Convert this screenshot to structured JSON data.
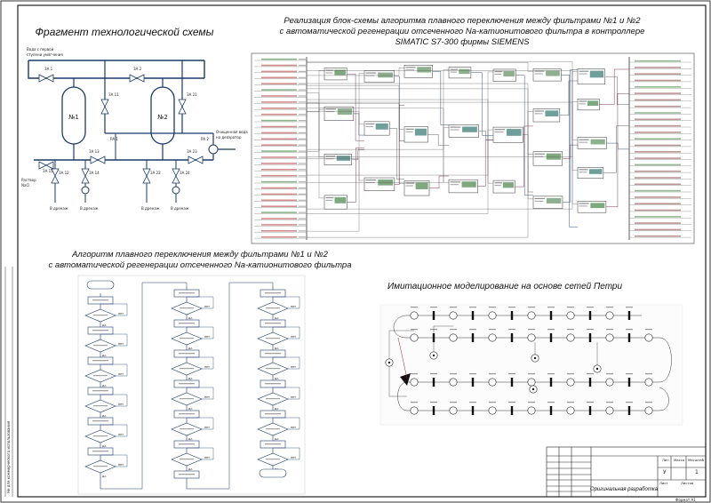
{
  "titles": {
    "tech_scheme": "Фрагмент технологической схемы",
    "plc_impl_lines": [
      "Реализация блок-схемы алгоритма плавного переключения между фильтрами №1 и №2",
      "с автоматической регенерации отсеченного Na-катионитового фильтра в контроллере",
      "SIMATIC S7-300 фирмы SIEMENS"
    ],
    "algorithm_lines": [
      "Алгоритм плавного переключения между фильтрами №1 и №2",
      "с автоматической регенерации отсеченного Na-катионитового фильтра"
    ],
    "petri": "Имитационное моделирование на основе сетей Петри"
  },
  "tech": {
    "filter1": "№1",
    "filter2": "№2",
    "inlet_label": [
      "Вода с первой",
      "ступени умягчения"
    ],
    "outlet_label": [
      "Очищенная вода",
      "на деаэратор"
    ],
    "wash_label": [
      "Раствор",
      "NaCl"
    ],
    "drain": "В дренаж",
    "valves": [
      "ЗА 1",
      "ЗА 2",
      "ЗА 11",
      "ЗА 21",
      "ЗА 12",
      "ЗА 22",
      "ЗА 13",
      "ЗА 23",
      "ЗА 14",
      "ЗА 24",
      "ЗА 15",
      "ЗА 25",
      "ЗА 16",
      "ЗА 26",
      "РА 1",
      "РА 2"
    ]
  },
  "flowchart": {
    "start": "Начало",
    "end": "Конец",
    "yes": "ДА",
    "no": "НЕТ"
  },
  "stamp": {
    "doc_title": "Оригинальная разработка",
    "sheet_label": "Лист",
    "sheets_label": "Листов",
    "mass_label": "Масса",
    "scale_label": "Масштаб",
    "sheet_no": "1",
    "letter": "У",
    "format": "Формат А1"
  },
  "margin_note": "Не для коммерческого использования"
}
